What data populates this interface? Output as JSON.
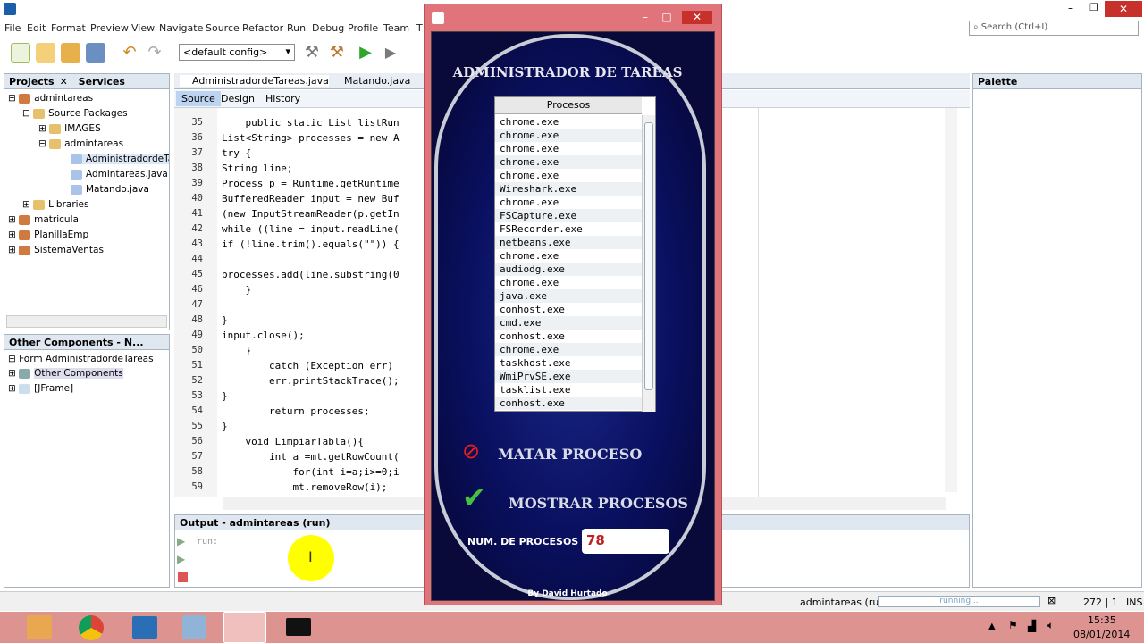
{
  "ide": {
    "menu": [
      "File",
      "Edit",
      "Format",
      "Preview",
      "View",
      "Navigate",
      "Source",
      "Refactor",
      "Run",
      "Debug",
      "Profile",
      "Team",
      "T"
    ],
    "config": "<default config>",
    "search_placeholder": "Search (Ctrl+I)",
    "projects": {
      "tab1": "Projects",
      "tab2": "Services",
      "items": [
        "admintareas",
        "Source Packages",
        "IMAGES",
        "admintareas",
        "AdministradordeTare",
        "Admintareas.java",
        "Matando.java",
        "Libraries",
        "matricula",
        "PlanillaEmp",
        "SistemaVentas"
      ]
    },
    "components": {
      "title": "Other Components - N...",
      "items": [
        "Form AdministradordeTareas",
        "Other Components",
        "[JFrame]"
      ]
    },
    "editor_tabs": [
      "AdministradordeTareas.java",
      "Matando.java"
    ],
    "editor_subtabs": [
      "Source",
      "Design",
      "History"
    ],
    "line_numbers": [
      "35",
      "36",
      "37",
      "38",
      "39",
      "40",
      "41",
      "42",
      "43",
      "44",
      "45",
      "46",
      "47",
      "48",
      "49",
      "50",
      "51",
      "52",
      "53",
      "54",
      "55",
      "56",
      "57",
      "58",
      "59"
    ],
    "code_lines": [
      "    public static List listRun",
      "List<String> processes = new A",
      "try {",
      "String line;",
      "Process p = Runtime.getRuntime",
      "BufferedReader input = new Buf",
      "(new InputStreamReader(p.getIn",
      "while ((line = input.readLine(",
      "if (!line.trim().equals(\"\")) {",
      "",
      "processes.add(line.substring(0",
      "    }",
      "",
      "}",
      "input.close();",
      "    }",
      "        catch (Exception err)",
      "        err.printStackTrace();",
      "}",
      "        return processes;",
      "}",
      "    void LimpiarTabla(){",
      "        int a =mt.getRowCount(",
      "            for(int i=a;i>=0;i",
      "            mt.removeRow(i);"
    ],
    "palette": "Palette",
    "output_title": "Output - admintareas (run)",
    "output_text": "run:",
    "status": {
      "project": "admintareas (run)",
      "progress": "running...",
      "position": "272 | 1",
      "mode": "INS"
    }
  },
  "app": {
    "title": "ADMINISTRADOR DE TAREAS",
    "column": "Procesos",
    "processes": [
      "chrome.exe",
      "chrome.exe",
      "chrome.exe",
      "chrome.exe",
      "chrome.exe",
      "Wireshark.exe",
      "chrome.exe",
      "FSCapture.exe",
      "FSRecorder.exe",
      "netbeans.exe",
      "chrome.exe",
      "audiodg.exe",
      "chrome.exe",
      "java.exe",
      "conhost.exe",
      "cmd.exe",
      "conhost.exe",
      "chrome.exe",
      "taskhost.exe",
      "WmiPrvSE.exe",
      "tasklist.exe",
      "conhost.exe"
    ],
    "kill_label": "MATAR PROCESO",
    "show_label": "MOSTRAR PROCESOS",
    "count_label": "NUM. DE PROCESOS",
    "count_value": "78",
    "author": "By David Hurtado"
  },
  "clock": {
    "time": "15:35",
    "date": "08/01/2014"
  }
}
